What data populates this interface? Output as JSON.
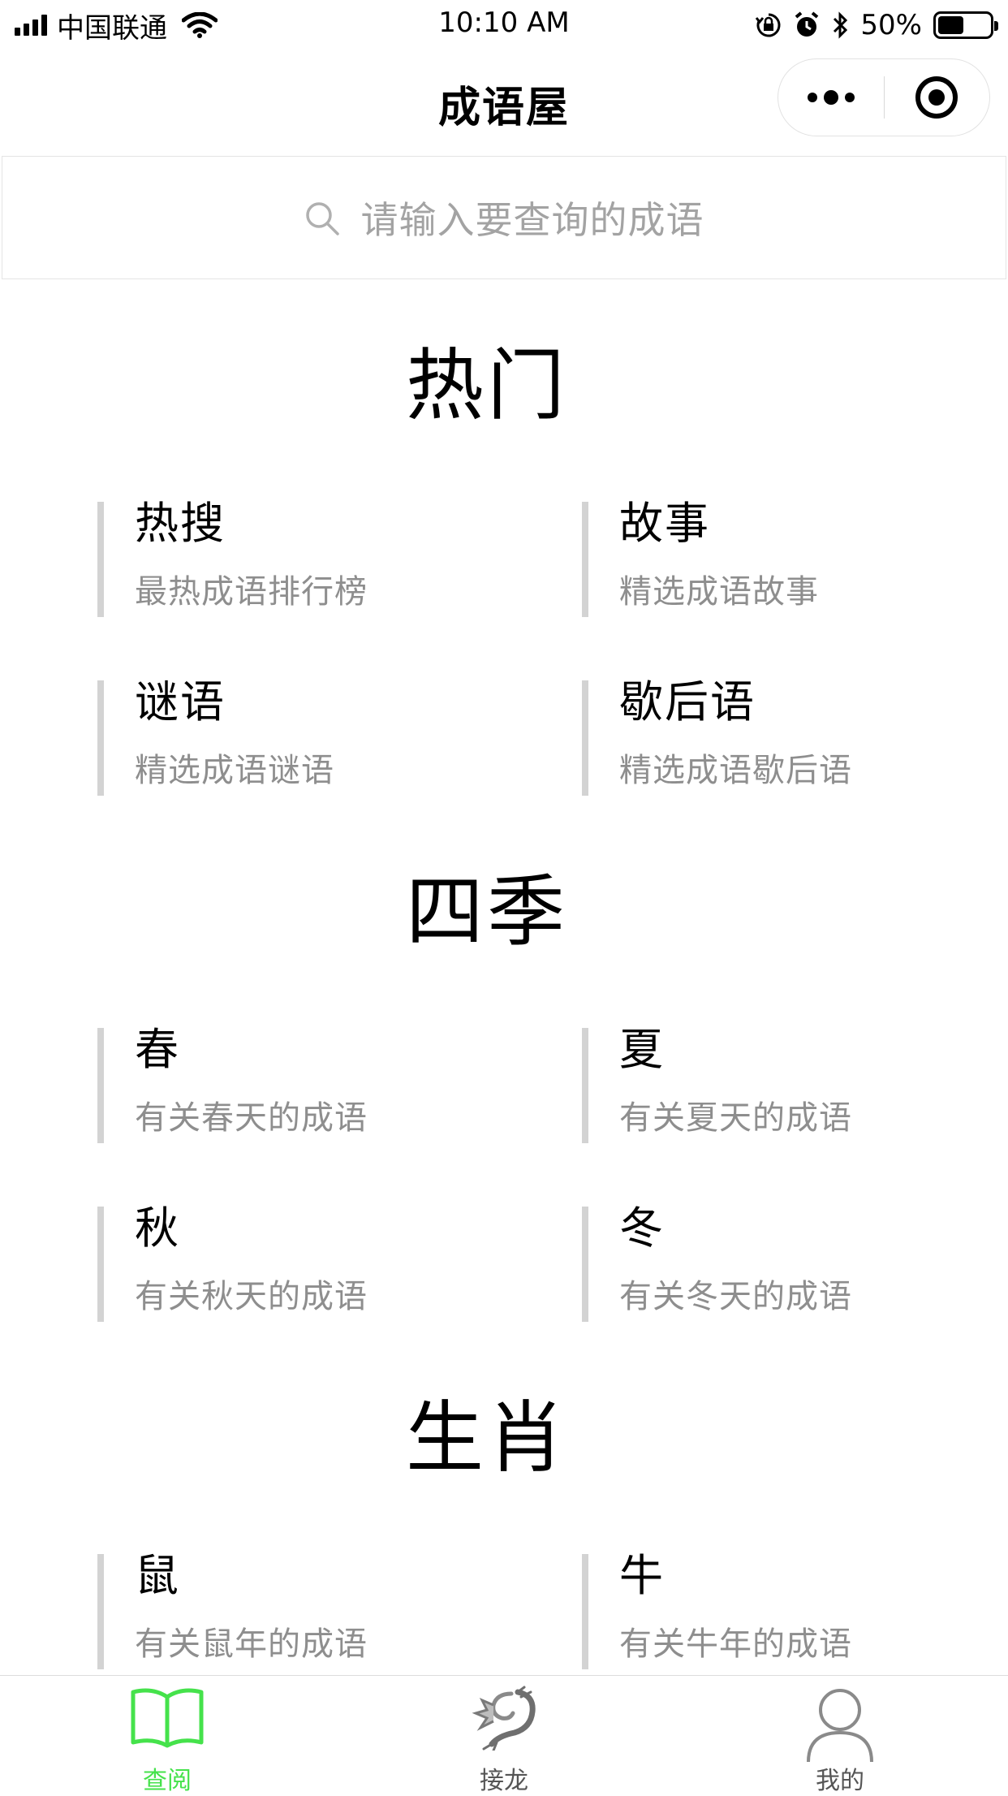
{
  "status_bar": {
    "carrier": "中国联通",
    "time": "10:10 AM",
    "battery_percent": "50%",
    "battery_level": 0.5
  },
  "nav": {
    "title": "成语屋"
  },
  "search": {
    "placeholder": "请输入要查询的成语"
  },
  "sections": [
    {
      "title": "热门",
      "cards": [
        {
          "title": "热搜",
          "subtitle": "最热成语排行榜"
        },
        {
          "title": "故事",
          "subtitle": "精选成语故事"
        },
        {
          "title": "谜语",
          "subtitle": "精选成语谜语"
        },
        {
          "title": "歇后语",
          "subtitle": "精选成语歇后语"
        }
      ]
    },
    {
      "title": "四季",
      "cards": [
        {
          "title": "春",
          "subtitle": "有关春天的成语"
        },
        {
          "title": "夏",
          "subtitle": "有关夏天的成语"
        },
        {
          "title": "秋",
          "subtitle": "有关秋天的成语"
        },
        {
          "title": "冬",
          "subtitle": "有关冬天的成语"
        }
      ]
    },
    {
      "title": "生肖",
      "cards": [
        {
          "title": "鼠",
          "subtitle": "有关鼠年的成语"
        },
        {
          "title": "牛",
          "subtitle": "有关牛年的成语"
        }
      ]
    }
  ],
  "tab_bar": {
    "tabs": [
      {
        "label": "查阅",
        "icon": "book-icon",
        "active": true
      },
      {
        "label": "接龙",
        "icon": "dragon-icon",
        "active": false
      },
      {
        "label": "我的",
        "icon": "user-icon",
        "active": false
      }
    ],
    "active_color": "#45e24b"
  }
}
